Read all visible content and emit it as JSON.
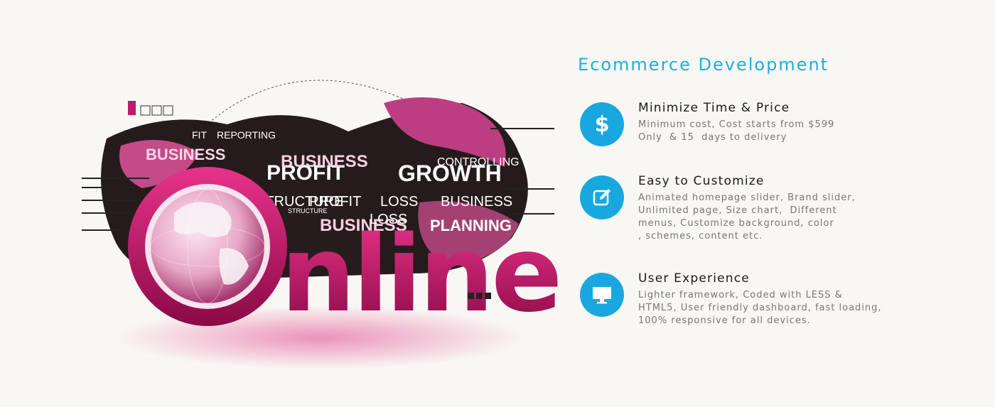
{
  "hero": {
    "background_words": [
      "BUSINESS",
      "PROFIT",
      "GROWTH",
      "STRUCTURE",
      "BUSINESS",
      "LOSS",
      "CONTROLLING",
      "PROFIT",
      "BUSINESS",
      "STRUCTURE",
      "BUSINESS",
      "PLANNING",
      "FIT",
      "REPORTING",
      "PROFIT",
      "LOSS"
    ],
    "main_word_first": "O",
    "main_word_rest": "nline",
    "accent_color": "#d6186c"
  },
  "panel": {
    "title": "Ecommerce Development",
    "features": [
      {
        "icon": "dollar-icon",
        "glyph": "$",
        "title": "Minimize Time & Price",
        "lines": [
          "Minimum cost, Cost starts from $599",
          "Only  & 15  days to delivery"
        ]
      },
      {
        "icon": "edit-icon",
        "title": "Easy to Customize",
        "lines": [
          "Animated homepage slider, Brand slider,",
          "Unlimited page, Size chart,  Different",
          "menus, Customize background, color",
          ", schemes, content etc."
        ]
      },
      {
        "icon": "monitor-icon",
        "title": "User Experience",
        "lines": [
          "Lighter framework, Coded with LESS &",
          "HTML5, User friendly dashboard, fast loading,",
          "100% responsive for all devices."
        ]
      }
    ],
    "accent_color": "#18a8df"
  }
}
